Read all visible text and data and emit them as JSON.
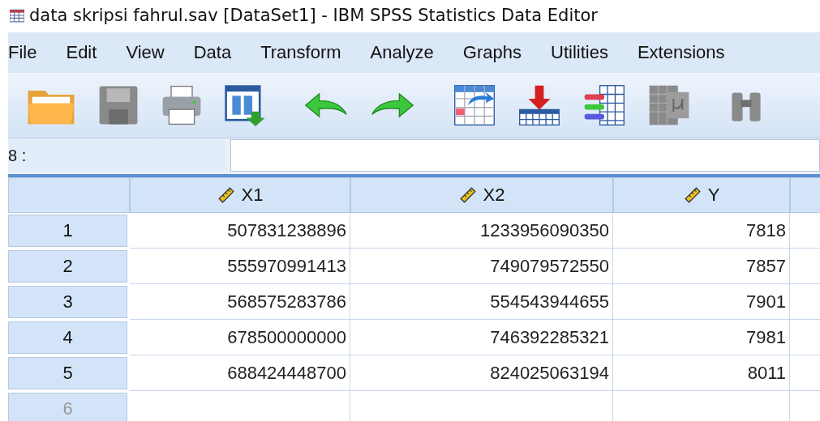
{
  "window": {
    "title": "data skripsi fahrul.sav [DataSet1] - IBM SPSS Statistics Data Editor"
  },
  "menu": [
    {
      "label": "File"
    },
    {
      "label": "Edit"
    },
    {
      "label": "View"
    },
    {
      "label": "Data"
    },
    {
      "label": "Transform"
    },
    {
      "label": "Analyze"
    },
    {
      "label": "Graphs"
    },
    {
      "label": "Utilities"
    },
    {
      "label": "Extensions"
    }
  ],
  "toolbar": [
    {
      "kind": "open",
      "disabled": false
    },
    {
      "kind": "save",
      "disabled": true
    },
    {
      "kind": "print",
      "disabled": false
    },
    {
      "kind": "dialog",
      "disabled": false
    },
    {
      "kind": "undo",
      "disabled": false
    },
    {
      "kind": "redo",
      "disabled": false
    },
    {
      "kind": "goto-case",
      "disabled": false
    },
    {
      "kind": "goto-variable",
      "disabled": false
    },
    {
      "kind": "variables",
      "disabled": false
    },
    {
      "kind": "run-descriptives",
      "disabled": true
    },
    {
      "kind": "find",
      "disabled": true
    }
  ],
  "cell_editor": {
    "reference": "8 :"
  },
  "table": {
    "columns": [
      {
        "label": "X1"
      },
      {
        "label": "X2"
      },
      {
        "label": "Y"
      }
    ],
    "rows": [
      {
        "label": "1",
        "cells": [
          "507831238896",
          "1233956090350",
          "7818"
        ]
      },
      {
        "label": "2",
        "cells": [
          "555970991413",
          "749079572550",
          "7857"
        ]
      },
      {
        "label": "3",
        "cells": [
          "568575283786",
          "554543944655",
          "7901"
        ]
      },
      {
        "label": "4",
        "cells": [
          "678500000000",
          "746392285321",
          "7981"
        ]
      },
      {
        "label": "5",
        "cells": [
          "688424448700",
          "824025063194",
          "8011"
        ]
      },
      {
        "label": "6"
      }
    ]
  }
}
